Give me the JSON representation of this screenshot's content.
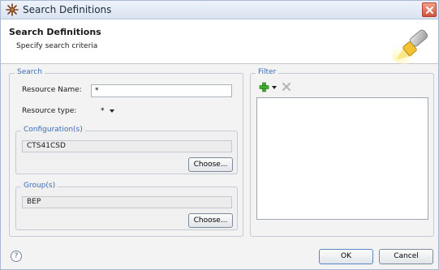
{
  "window": {
    "title": "Search Definitions"
  },
  "header": {
    "title": "Search Definitions",
    "subtitle": "Specify search criteria"
  },
  "search": {
    "legend": "Search",
    "resource_name_label": "Resource Name:",
    "resource_name_value": "*",
    "resource_type_label": "Resource type:",
    "resource_type_value": "*",
    "configuration": {
      "legend": "Configuration(s)",
      "value": "CTS41CSD",
      "choose_label": "Choose..."
    },
    "group": {
      "legend": "Group(s)",
      "value": "BEP",
      "choose_label": "Choose..."
    }
  },
  "filter": {
    "legend": "Filter",
    "add_icon": "green-plus-icon",
    "remove_icon": "gray-x-icon",
    "items": []
  },
  "footer": {
    "help_symbol": "?",
    "ok_label": "OK",
    "cancel_label": "Cancel"
  },
  "colors": {
    "legend_blue": "#3e6db5",
    "close_red": "#d2533d",
    "add_green": "#3bab2a"
  }
}
